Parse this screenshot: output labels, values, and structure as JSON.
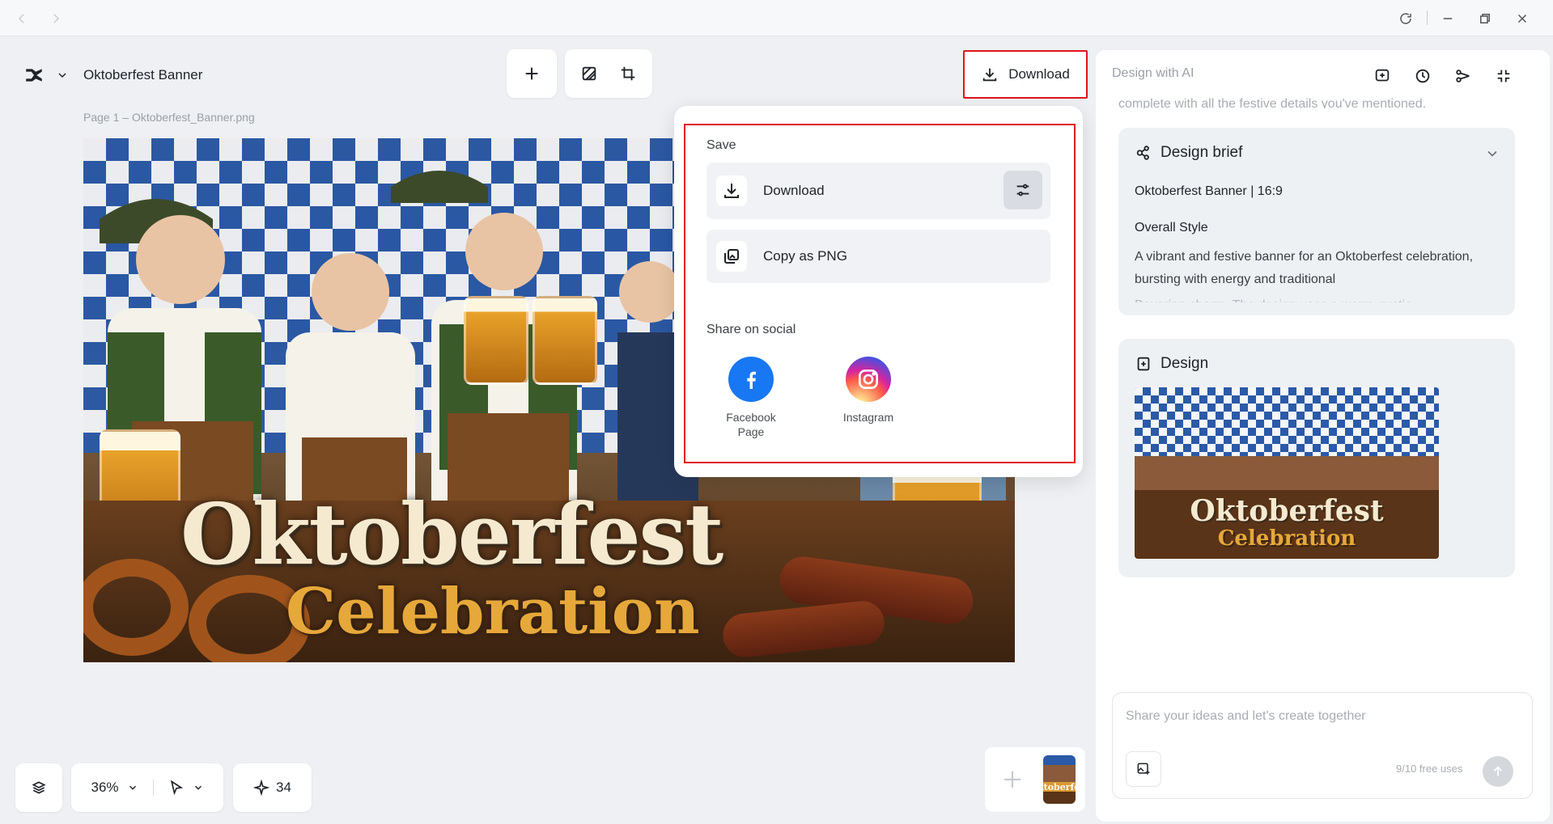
{
  "window": {
    "refresh_icon": "refresh-icon",
    "minimize_icon": "minimize-icon",
    "restore_icon": "restore-icon",
    "close_icon": "close-icon"
  },
  "header": {
    "project_title": "Oktoberfest Banner",
    "download_label": "Download"
  },
  "canvas": {
    "file_label": "Page 1 –  Oktoberfest_Banner.png",
    "headline": "Oktoberfest",
    "subheadline": "Celebration"
  },
  "bottom_toolbar": {
    "zoom": "36%",
    "credits": "34"
  },
  "download_popup": {
    "save_heading": "Save",
    "download_label": "Download",
    "copy_label": "Copy as PNG",
    "share_heading": "Share on social",
    "facebook_label": "Facebook Page",
    "instagram_label": "Instagram"
  },
  "ai_panel": {
    "title": "Design with AI",
    "faded_message": "complete with all the festive details you've mentioned.",
    "brief": {
      "heading": "Design brief",
      "subtitle": "Oktoberfest Banner | 16:9",
      "section": "Overall Style",
      "text": "A vibrant and festive banner for an Oktoberfest celebration, bursting with energy and traditional",
      "faded_text": "Bavarian charm. The design uses a warm, rustic"
    },
    "design": {
      "heading": "Design",
      "thumb_title": "Oktoberfest",
      "thumb_sub": "Celebration"
    },
    "chat": {
      "placeholder": "Share your ideas and let's create together",
      "free_uses": "9/10 free uses"
    }
  },
  "colors": {
    "accent_red": "#e0141e",
    "facebook_blue": "#1877f2",
    "panel_bg": "#eef1f4"
  }
}
